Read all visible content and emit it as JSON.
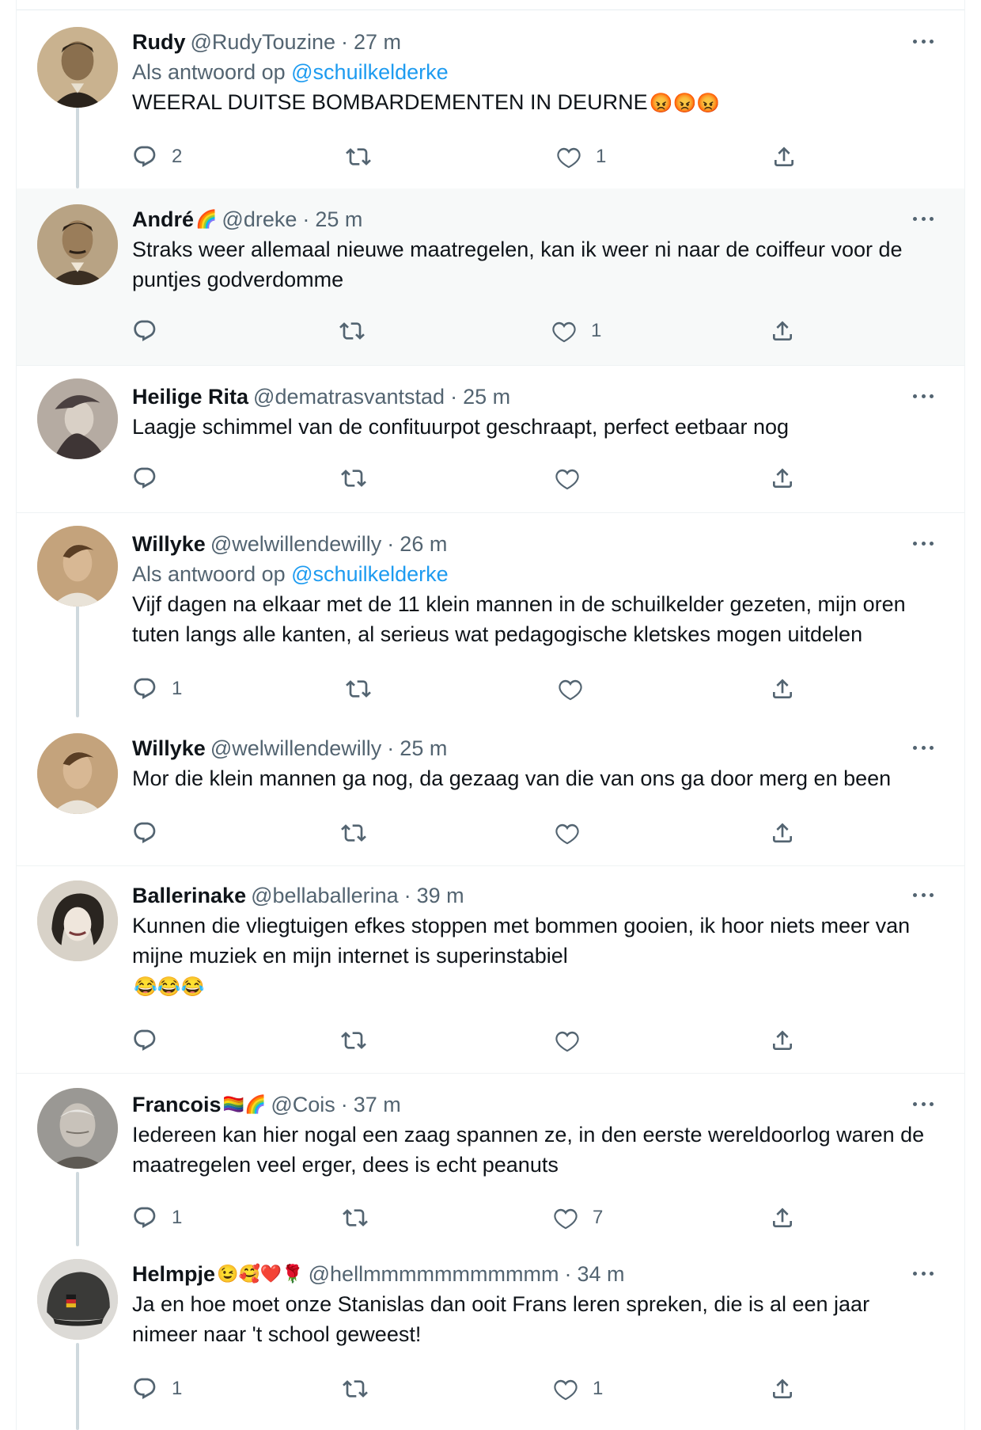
{
  "tweets": [
    {
      "name": "Rudy",
      "handle": "@RudyTouzine",
      "time": "27 m",
      "reply_prefix": "Als antwoord op",
      "reply_mention": "@schuilkelderke",
      "text": "WEERAL DUITSE BOMBARDEMENTEN IN DEURNE",
      "text_emoji": "😡😡😡",
      "replies": "2",
      "retweets": "",
      "likes": "1"
    },
    {
      "name": "André",
      "name_emoji": "🌈",
      "handle": "@dreke",
      "time": "25 m",
      "text": "Straks weer allemaal nieuwe maatregelen, kan ik weer ni naar de coiffeur voor de puntjes godverdomme",
      "replies": "",
      "retweets": "",
      "likes": "1"
    },
    {
      "name": "Heilige Rita",
      "handle": "@dematrasvantstad",
      "time": "25 m",
      "text": "Laagje schimmel van de confituurpot geschraapt, perfect eetbaar nog",
      "replies": "",
      "retweets": "",
      "likes": ""
    },
    {
      "name": "Willyke",
      "handle": "@welwillendewilly",
      "time": "26 m",
      "reply_prefix": "Als antwoord op",
      "reply_mention": "@schuilkelderke",
      "text": "Vijf dagen na elkaar met de 11 klein mannen in de schuilkelder gezeten, mijn oren tuten langs alle kanten, al serieus wat pedagogische kletskes mogen uitdelen",
      "replies": "1",
      "retweets": "",
      "likes": ""
    },
    {
      "name": "Willyke",
      "handle": "@welwillendewilly",
      "time": "25 m",
      "text": "Mor die klein mannen ga nog, da gezaag van die van ons ga door merg en been",
      "replies": "",
      "retweets": "",
      "likes": ""
    },
    {
      "name": "Ballerinake",
      "handle": "@bellaballerina",
      "time": "39 m",
      "text": "Kunnen die vliegtuigen efkes stoppen met bommen gooien, ik hoor niets meer van mijne muziek en mijn internet is superinstabiel",
      "text_emoji": "😂😂😂",
      "replies": "",
      "retweets": "",
      "likes": ""
    },
    {
      "name": "Francois",
      "name_emoji": "🏳️‍🌈🌈",
      "handle": "@Cois",
      "time": "37 m",
      "text": "Iedereen kan hier nogal een zaag spannen ze, in den eerste wereldoorlog waren de maatregelen veel erger, dees is echt peanuts",
      "replies": "1",
      "retweets": "",
      "likes": "7"
    },
    {
      "name": "Helmpje",
      "name_emoji": "😉🥰❤️🌹",
      "handle": "@hellmmmmmmmmmmm",
      "time": "34 m",
      "text": "Ja en hoe moet onze Stanislas dan ooit Frans leren spreken, die is al een jaar nimeer naar 't school geweest!",
      "replies": "1",
      "retweets": "",
      "likes": "1"
    }
  ],
  "icons": {
    "reply": "reply-icon",
    "retweet": "retweet-icon",
    "like": "like-icon",
    "share": "share-icon",
    "more": "more-icon"
  },
  "colors": {
    "text": "#0f1419",
    "secondary": "#536471",
    "link": "#1d9bf0",
    "highlight_bg": "#f7f9f9",
    "thread_line": "#cfd9de"
  }
}
